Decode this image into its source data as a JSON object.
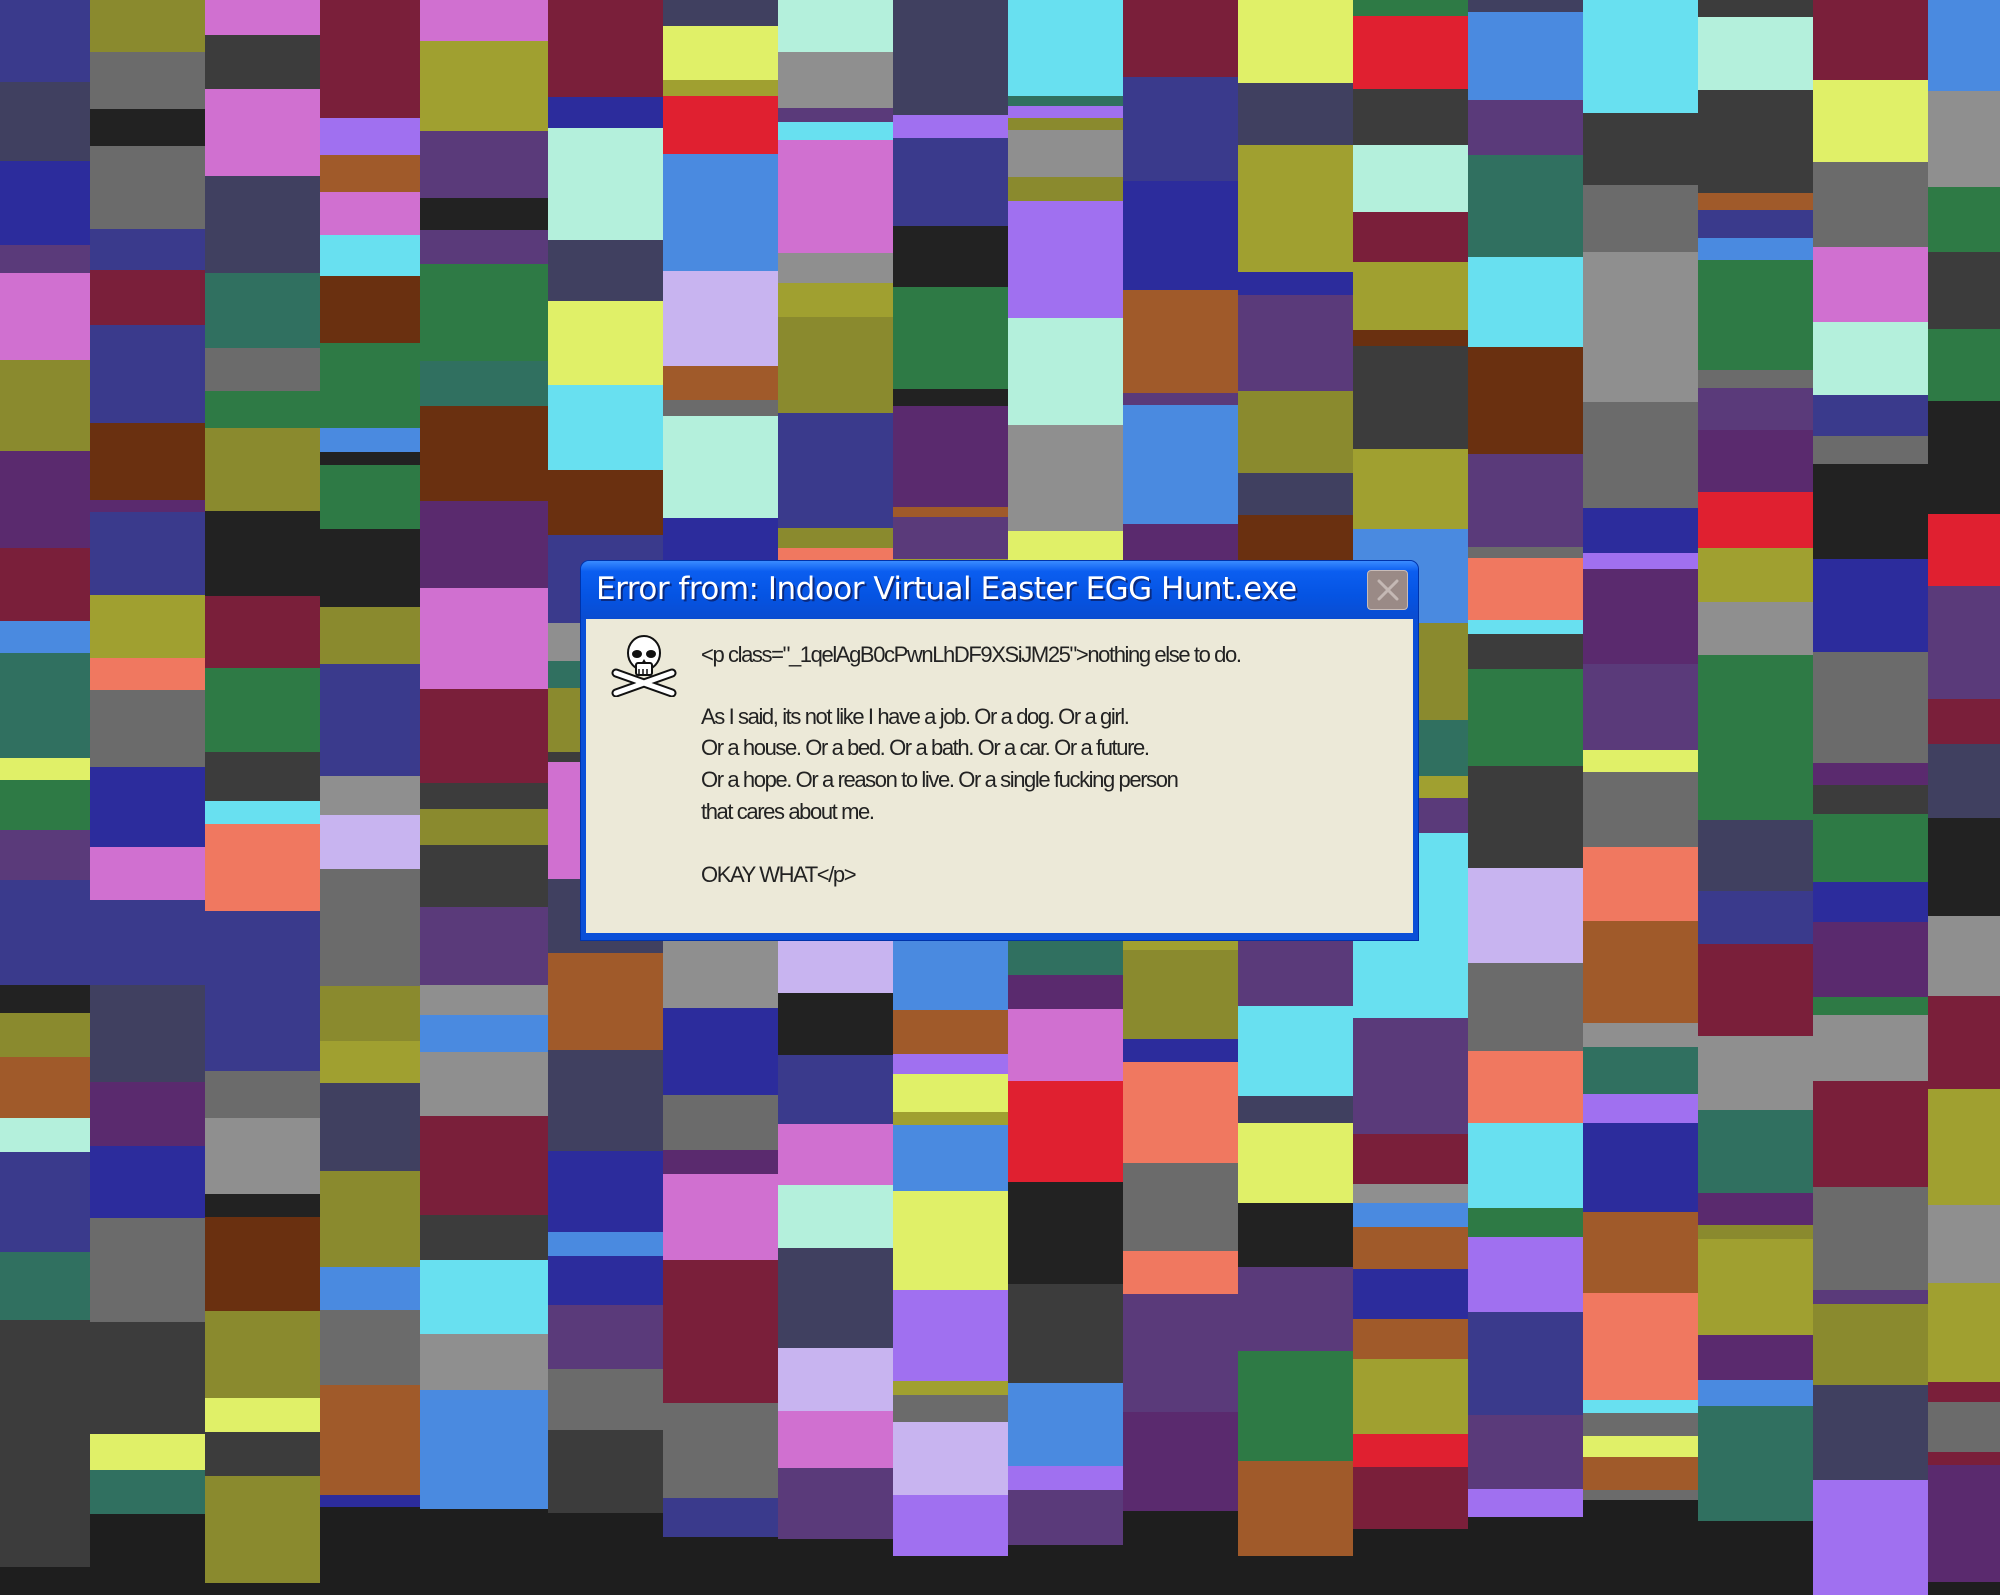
{
  "background": {
    "palette": [
      "#6b6b6b",
      "#8f8f8f",
      "#3c3c3c",
      "#222222",
      "#5a2a6e",
      "#7a1f3a",
      "#2e7a45",
      "#3a3a8c",
      "#8a8a2e",
      "#c8b4f0",
      "#b4f0dc",
      "#e0f068",
      "#f07860",
      "#68e0f0",
      "#a070f0",
      "#e02030",
      "#2c2c9c",
      "#6a3010",
      "#a05a2a",
      "#4a8ae0",
      "#d070d0",
      "#307060",
      "#5a3a7a",
      "#a0a030",
      "#404060"
    ]
  },
  "dialog": {
    "title": "Error from: Indoor Virtual Easter EGG Hunt.exe",
    "close_icon": "x-icon",
    "message_icon": "skull-and-crossbones-icon",
    "lines": [
      "<p class=\"_1qelAgB0cPwnLhDF9XSiJM25\">nothing else to do.",
      "As I said, its not like I have a job. Or a dog. Or a girl.",
      "Or a house. Or a bed. Or a bath. Or a car. Or a future.",
      "Or a hope. Or a reason to live. Or a single fucking person",
      "that cares about me.",
      "OKAY WHAT</p>"
    ]
  }
}
